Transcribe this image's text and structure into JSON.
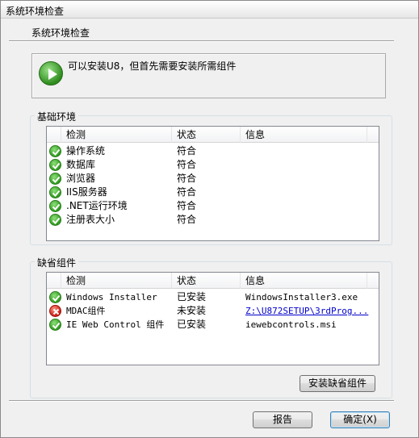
{
  "window": {
    "title": "系统环境检查"
  },
  "header": {
    "title": "系统环境检查"
  },
  "message": {
    "text": "可以安装U8，但首先需要安装所需组件"
  },
  "basic_env": {
    "group_title": "基础环境",
    "columns": [
      "检测",
      "状态",
      "信息"
    ],
    "rows": [
      {
        "name": "操作系统",
        "status": "符合",
        "info": "",
        "icon": "check-icon"
      },
      {
        "name": "数据库",
        "status": "符合",
        "info": "",
        "icon": "check-icon"
      },
      {
        "name": "浏览器",
        "status": "符合",
        "info": "",
        "icon": "check-icon"
      },
      {
        "name": "IIS服务器",
        "status": "符合",
        "info": "",
        "icon": "check-icon"
      },
      {
        "name": ".NET运行环境",
        "status": "符合",
        "info": "",
        "icon": "check-icon"
      },
      {
        "name": "注册表大小",
        "status": "符合",
        "info": "",
        "icon": "check-icon"
      }
    ]
  },
  "missing": {
    "group_title": "缺省组件",
    "columns": [
      "检测",
      "状态",
      "信息"
    ],
    "rows": [
      {
        "name": "Windows Installer",
        "status": "已安装",
        "info": "WindowsInstaller3.exe",
        "icon": "check-icon"
      },
      {
        "name": "MDAC组件",
        "status": "未安装",
        "info": "Z:\\U872SETUP\\3rdProg...",
        "icon": "error-icon"
      },
      {
        "name": "IE Web Control 组件",
        "status": "已安装",
        "info": "iewebcontrols.msi",
        "icon": "check-icon"
      }
    ],
    "install_button": "安装缺省组件"
  },
  "footer": {
    "report_button": "报告",
    "ok_button": "确定(X)"
  },
  "colors": {
    "ok": "#2f9b1f",
    "error": "#c71c12",
    "link": "#0000cc"
  }
}
